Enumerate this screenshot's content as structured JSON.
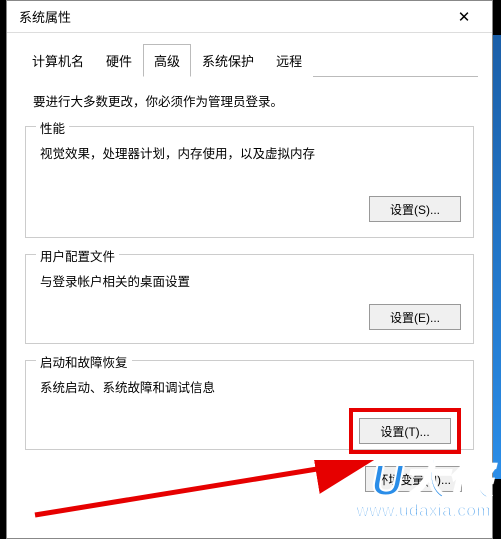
{
  "window": {
    "title": "系统属性"
  },
  "tabs": [
    {
      "label": "计算机名",
      "active": false
    },
    {
      "label": "硬件",
      "active": false
    },
    {
      "label": "高级",
      "active": true
    },
    {
      "label": "系统保护",
      "active": false
    },
    {
      "label": "远程",
      "active": false
    }
  ],
  "admin_note": "要进行大多数更改，你必须作为管理员登录。",
  "performance": {
    "legend": "性能",
    "desc": "视觉效果，处理器计划，内存使用，以及虚拟内存",
    "button": "设置(S)..."
  },
  "user_profiles": {
    "legend": "用户配置文件",
    "desc": "与登录帐户相关的桌面设置",
    "button": "设置(E)..."
  },
  "startup": {
    "legend": "启动和故障恢复",
    "desc": "系统启动、系统故障和调试信息",
    "button": "设置(T)..."
  },
  "env_button": "环境变量(N)...",
  "watermark": {
    "main": "U大侠",
    "sub": "www.udaxia.com"
  }
}
